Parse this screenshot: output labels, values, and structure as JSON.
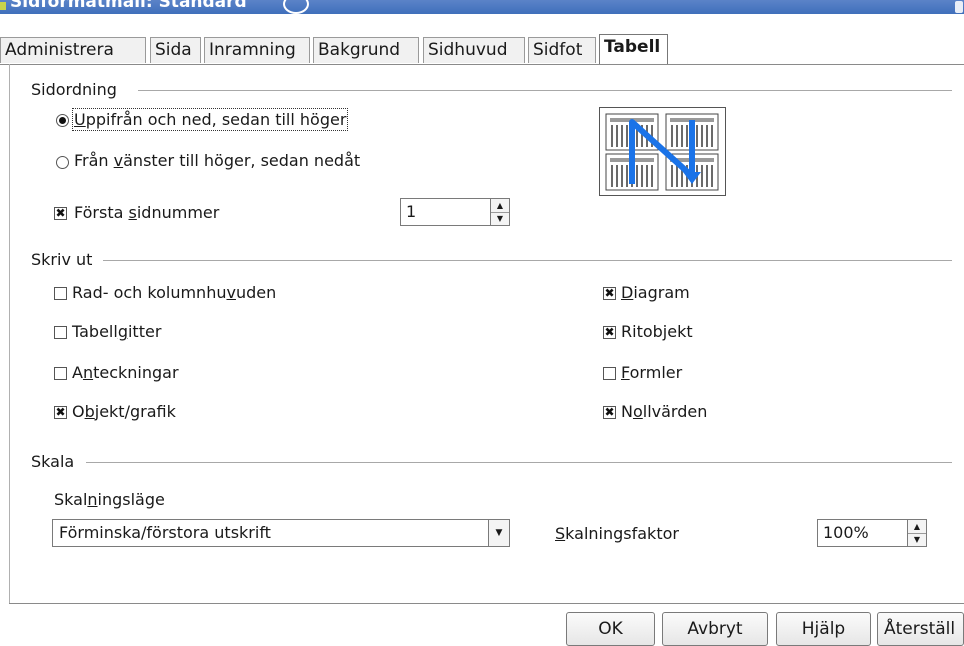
{
  "window": {
    "title": "Sidformatmall: Standard"
  },
  "tabs": [
    {
      "label": "Administrera"
    },
    {
      "label": "Sida"
    },
    {
      "label": "Inramning"
    },
    {
      "label": "Bakgrund"
    },
    {
      "label": "Sidhuvud"
    },
    {
      "label": "Sidfot"
    },
    {
      "label": "Tabell"
    }
  ],
  "active_tab": "Tabell",
  "sidordning": {
    "header": "Sidordning",
    "option1": {
      "u": "U",
      "rest": "ppifrån och ned, sedan till höger",
      "selected": true
    },
    "option2": {
      "pre": "Från ",
      "u": "v",
      "rest": "änster till höger, sedan nedåt",
      "selected": false
    },
    "forsta": {
      "pre": "Första ",
      "u": "s",
      "rest": "idnummer",
      "checked": true,
      "value": "1"
    }
  },
  "skrivut": {
    "header": "Skriv ut",
    "left": [
      {
        "pre": "Rad- och kolumnhu",
        "u": "v",
        "rest": "uden",
        "checked": false
      },
      {
        "pre": "Tabell",
        "u": "g",
        "rest": "itter",
        "checked": false
      },
      {
        "pre": "A",
        "u": "n",
        "rest": "teckningar",
        "checked": false
      },
      {
        "pre": "O",
        "u": "b",
        "rest": "jekt/grafik",
        "checked": true
      }
    ],
    "right": [
      {
        "pre": "",
        "u": "D",
        "rest": "iagram",
        "checked": true
      },
      {
        "pre": "Ritobjekt",
        "u": "",
        "rest": "",
        "checked": true
      },
      {
        "pre": "",
        "u": "F",
        "rest": "ormler",
        "checked": false
      },
      {
        "pre": "N",
        "u": "o",
        "rest": "llvärden",
        "checked": true
      }
    ]
  },
  "skala": {
    "header": "Skala",
    "mode_label": {
      "pre": "Skal",
      "u": "n",
      "rest": "ingsläge"
    },
    "mode_value": "Förminska/förstora utskrift",
    "factor_label": {
      "pre": "",
      "u": "S",
      "rest": "kalningsfaktor"
    },
    "factor_value": "100%"
  },
  "buttons": {
    "ok": "OK",
    "cancel": "Avbryt",
    "help": "Hjälp",
    "reset": "Återställ"
  },
  "colors": {
    "arrow": "#1a73e8",
    "titlebar": "#3f6fbb"
  },
  "icons": {
    "preview": "page-order-preview-icon",
    "check": "✖"
  }
}
